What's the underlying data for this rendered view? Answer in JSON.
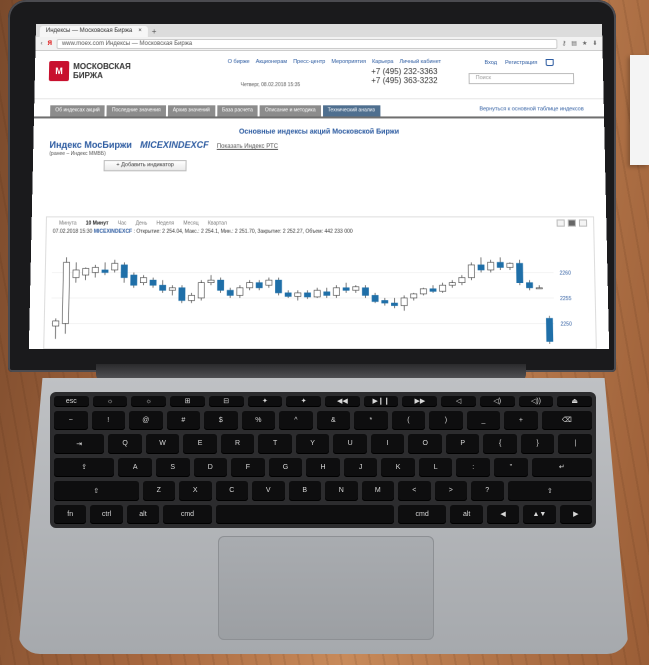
{
  "browser": {
    "tab_title": "Индексы — Московская Биржа",
    "tab_close": "×",
    "new_tab": "+",
    "yandex": "Я",
    "url": "www.moex.com   Индексы — Московская Биржа"
  },
  "site": {
    "logo_mark": "М",
    "logo_text": "МОСКОВСКАЯ БИРЖА",
    "topnav": [
      "О бирже",
      "Акционерам",
      "Пресс-центр",
      "Мероприятия",
      "Карьера",
      "Личный кабинет"
    ],
    "login": "Вход",
    "register": "Регистрация",
    "date_line": "Четверг, 08.02.2018 15:35",
    "phone1": "+7 (495) 232-3363",
    "phone2": "+7 (495) 363-3232",
    "search_placeholder": "Поиск"
  },
  "tabs": {
    "items": [
      "Об индексах акций",
      "Последние значения",
      "Архив значений",
      "База расчета",
      "Описание и методика",
      "Технический анализ"
    ],
    "back_link": "Вернуться к основной таблице индексов"
  },
  "index": {
    "section_title": "Основные индексы акций Московской Биржи",
    "name": "Индекс МосБиржи",
    "code": "MICEXINDEXCF",
    "rts_link": "Показать Индекс РТС",
    "subtitle": "(ранее – Индекс ММВБ)",
    "add_indicator": "+ Добавить индикатор"
  },
  "chart_controls": {
    "intervals": [
      "Минута",
      "10 Минут",
      "Час",
      "День",
      "Неделя",
      "Месяц",
      "Квартал"
    ],
    "active_interval": "10 Минут",
    "ohlc_time": "07.02.2018 15:30",
    "ohlc_code": "MICEXINDEXCF",
    "ohlc_values": ": Открытие: 2 254.04, Макс.: 2 254.1, Мин.: 2 251.70, Закрытие: 2 252.27, Объем: 442 233 000"
  },
  "chart_data": {
    "type": "candlestick",
    "y_ticks": [
      2260,
      2255,
      2250
    ],
    "ylim": [
      2246,
      2266
    ],
    "candles": [
      {
        "o": 2249.5,
        "h": 2251,
        "l": 2247,
        "c": 2250.5
      },
      {
        "o": 2250,
        "h": 2263,
        "l": 2248,
        "c": 2262
      },
      {
        "o": 2259,
        "h": 2262,
        "l": 2258,
        "c": 2260.5
      },
      {
        "o": 2259.5,
        "h": 2261,
        "l": 2258.5,
        "c": 2260.8
      },
      {
        "o": 2260,
        "h": 2261.5,
        "l": 2259,
        "c": 2261
      },
      {
        "o": 2260.5,
        "h": 2262,
        "l": 2259.5,
        "c": 2260
      },
      {
        "o": 2260.5,
        "h": 2262.5,
        "l": 2260,
        "c": 2261.8
      },
      {
        "o": 2261.5,
        "h": 2262,
        "l": 2258,
        "c": 2259
      },
      {
        "o": 2259.5,
        "h": 2260,
        "l": 2257,
        "c": 2257.5
      },
      {
        "o": 2258,
        "h": 2259.5,
        "l": 2257.5,
        "c": 2259
      },
      {
        "o": 2258.5,
        "h": 2259,
        "l": 2257,
        "c": 2257.5
      },
      {
        "o": 2257.5,
        "h": 2258.5,
        "l": 2256,
        "c": 2256.5
      },
      {
        "o": 2256.5,
        "h": 2257.5,
        "l": 2255.5,
        "c": 2257
      },
      {
        "o": 2257,
        "h": 2257.5,
        "l": 2254,
        "c": 2254.5
      },
      {
        "o": 2254.5,
        "h": 2256,
        "l": 2254,
        "c": 2255.5
      },
      {
        "o": 2255,
        "h": 2258.5,
        "l": 2254.5,
        "c": 2258
      },
      {
        "o": 2258,
        "h": 2259.5,
        "l": 2257.5,
        "c": 2258.5
      },
      {
        "o": 2258.5,
        "h": 2259,
        "l": 2256,
        "c": 2256.5
      },
      {
        "o": 2256.5,
        "h": 2257,
        "l": 2255,
        "c": 2255.5
      },
      {
        "o": 2255.5,
        "h": 2257.5,
        "l": 2255,
        "c": 2257
      },
      {
        "o": 2257,
        "h": 2258.5,
        "l": 2256.5,
        "c": 2258
      },
      {
        "o": 2258,
        "h": 2258.5,
        "l": 2256.5,
        "c": 2257
      },
      {
        "o": 2257.5,
        "h": 2259,
        "l": 2257,
        "c": 2258.5
      },
      {
        "o": 2258.5,
        "h": 2259,
        "l": 2255.5,
        "c": 2256
      },
      {
        "o": 2256,
        "h": 2256.5,
        "l": 2255,
        "c": 2255.3
      },
      {
        "o": 2255.3,
        "h": 2256.5,
        "l": 2254.5,
        "c": 2256
      },
      {
        "o": 2256,
        "h": 2256.5,
        "l": 2254.8,
        "c": 2255.2
      },
      {
        "o": 2255.2,
        "h": 2257,
        "l": 2255,
        "c": 2256.5
      },
      {
        "o": 2256.2,
        "h": 2257,
        "l": 2255,
        "c": 2255.5
      },
      {
        "o": 2255.5,
        "h": 2257.5,
        "l": 2255,
        "c": 2257
      },
      {
        "o": 2257,
        "h": 2258,
        "l": 2256,
        "c": 2256.5
      },
      {
        "o": 2256.5,
        "h": 2257.5,
        "l": 2256,
        "c": 2257.2
      },
      {
        "o": 2257,
        "h": 2257.5,
        "l": 2255,
        "c": 2255.5
      },
      {
        "o": 2255.5,
        "h": 2256,
        "l": 2254,
        "c": 2254.3
      },
      {
        "o": 2254.5,
        "h": 2255,
        "l": 2253.5,
        "c": 2254
      },
      {
        "o": 2254,
        "h": 2255,
        "l": 2253,
        "c": 2253.5
      },
      {
        "o": 2253.5,
        "h": 2255.5,
        "l": 2252.5,
        "c": 2255
      },
      {
        "o": 2255,
        "h": 2256,
        "l": 2254.5,
        "c": 2255.8
      },
      {
        "o": 2255.8,
        "h": 2257,
        "l": 2255.5,
        "c": 2256.8
      },
      {
        "o": 2256.8,
        "h": 2257.5,
        "l": 2256,
        "c": 2256.3
      },
      {
        "o": 2256.3,
        "h": 2258,
        "l": 2256,
        "c": 2257.5
      },
      {
        "o": 2257.5,
        "h": 2258.5,
        "l": 2257,
        "c": 2258
      },
      {
        "o": 2258,
        "h": 2259.5,
        "l": 2257.5,
        "c": 2259
      },
      {
        "o": 2259,
        "h": 2262,
        "l": 2258.5,
        "c": 2261.5
      },
      {
        "o": 2261.5,
        "h": 2263,
        "l": 2260,
        "c": 2260.5
      },
      {
        "o": 2260.5,
        "h": 2262.5,
        "l": 2260,
        "c": 2262
      },
      {
        "o": 2262,
        "h": 2263,
        "l": 2260.5,
        "c": 2261
      },
      {
        "o": 2261,
        "h": 2262,
        "l": 2260.5,
        "c": 2261.8
      },
      {
        "o": 2261.8,
        "h": 2262.5,
        "l": 2257.5,
        "c": 2258
      },
      {
        "o": 2258,
        "h": 2258.5,
        "l": 2256.5,
        "c": 2257
      },
      {
        "o": 2257,
        "h": 2257.5,
        "l": 2256.8,
        "c": 2257
      },
      {
        "o": 2251,
        "h": 2251.5,
        "l": 2246,
        "c": 2246.5
      }
    ],
    "up_color": "#2e8b57",
    "down_color": "#1f6fa8"
  },
  "keyboard": {
    "rows": [
      [
        "esc",
        "☼",
        "☼",
        "⊞",
        "⊟",
        "✦",
        "✦",
        "◀◀",
        "▶❙❙",
        "▶▶",
        "◁",
        "◁)",
        "◁))",
        "⏏"
      ],
      [
        "~",
        "!",
        "@",
        "#",
        "$",
        "%",
        "^",
        "&",
        "*",
        "(",
        ")",
        "_",
        "+",
        "⌫"
      ],
      [
        "⇥",
        "Q",
        "W",
        "E",
        "R",
        "T",
        "Y",
        "U",
        "I",
        "O",
        "P",
        "{",
        "}",
        "|"
      ],
      [
        "⇪",
        "A",
        "S",
        "D",
        "F",
        "G",
        "H",
        "J",
        "K",
        "L",
        ":",
        "\"",
        "↵"
      ],
      [
        "⇧",
        "Z",
        "X",
        "C",
        "V",
        "B",
        "N",
        "M",
        "<",
        ">",
        "?",
        "⇧"
      ],
      [
        "fn",
        "ctrl",
        "alt",
        "cmd",
        " ",
        "cmd",
        "alt",
        "◀",
        "▲▼",
        "▶"
      ]
    ]
  },
  "colors": {
    "moex_red": "#c8102e",
    "link_blue": "#2b5aa0"
  }
}
